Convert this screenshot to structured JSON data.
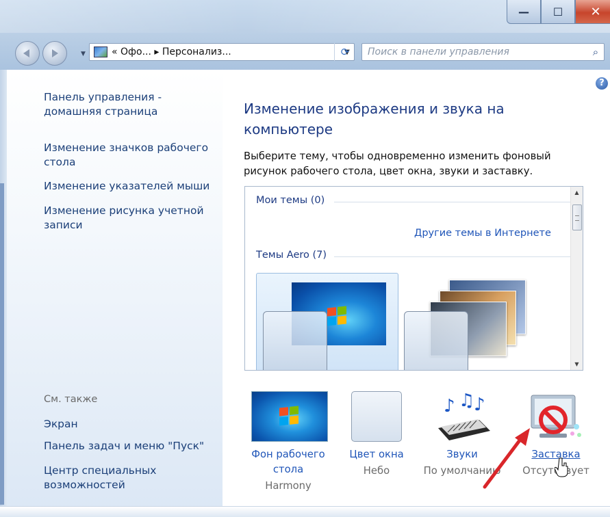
{
  "window": {
    "controls": {
      "minimize": "—",
      "maximize": "☐",
      "close": "✕"
    }
  },
  "navigation": {
    "back_icon": "back-arrow-icon",
    "forward_icon": "forward-arrow-icon",
    "address": "« Офо... ▸ Персонализ...",
    "search_placeholder": "Поиск в панели управления",
    "search_icon": "⌕",
    "refresh_icon": "⟳"
  },
  "sidebar": {
    "links": [
      "Панель управления - домашняя страница",
      "Изменение значков рабочего стола",
      "Изменение указателей мыши",
      "Изменение рисунка учетной записи"
    ],
    "see_also_label": "См. также",
    "see_also": [
      "Экран",
      "Панель задач и меню \"Пуск\"",
      "Центр специальных возможностей"
    ]
  },
  "main": {
    "help_icon": "?",
    "heading": "Изменение изображения и звука на компьютере",
    "description": "Выберите тему, чтобы одновременно изменить фоновый рисунок рабочего стола, цвет окна, звуки и заставку.",
    "themes": {
      "my_themes_label": "Мои темы (0)",
      "online_link": "Другие темы в Интернете",
      "aero_label": "Темы Aero (7)"
    },
    "bottom_settings": [
      {
        "link": "Фон рабочего стола",
        "value": "Harmony"
      },
      {
        "link": "Цвет окна",
        "value": "Небо"
      },
      {
        "link": "Звуки",
        "value": "По умолчанию"
      },
      {
        "link": "Заставка",
        "value": "Отсутствует"
      }
    ]
  },
  "colors": {
    "link_blue": "#1f55b8",
    "heading_blue": "#1d3a83",
    "sidebar_link": "#1b3f78",
    "annotation_arrow": "#d9262a"
  }
}
